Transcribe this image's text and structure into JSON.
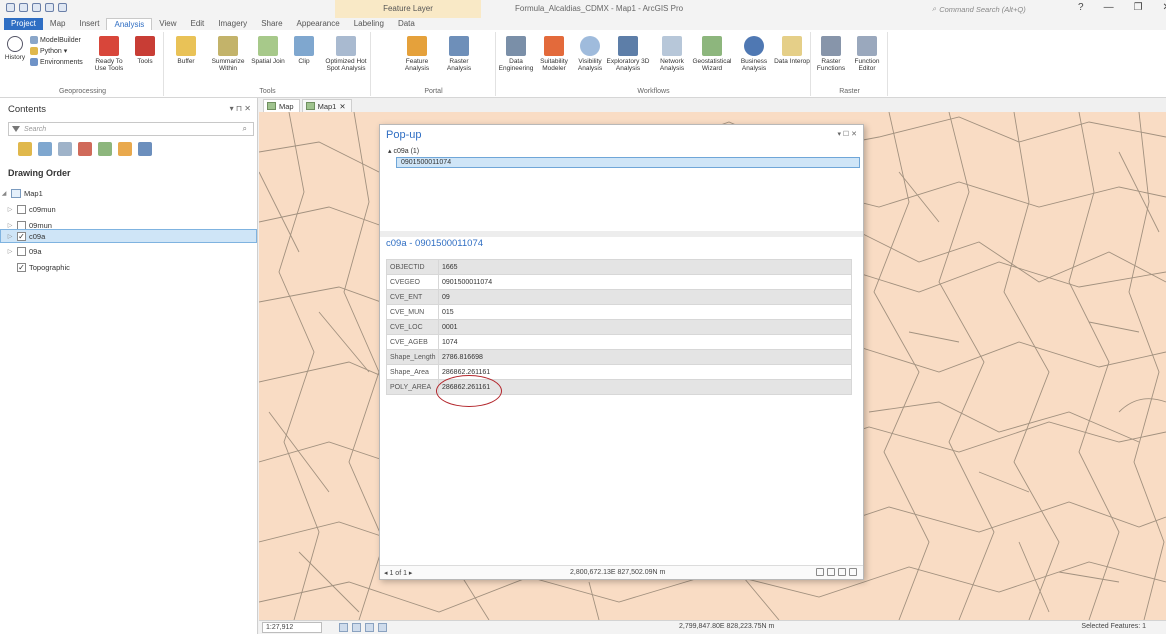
{
  "window": {
    "title": "Formula_Alcaldias_CDMX - Map1 - ArcGIS Pro",
    "contextual_tab": "Feature Layer",
    "command_search": "Command Search (Alt+Q)",
    "help": "?",
    "minimize": "—",
    "restore": "❐",
    "close": "✕"
  },
  "ribbon_tabs": [
    "Project",
    "Map",
    "Insert",
    "Analysis",
    "View",
    "Edit",
    "Imagery",
    "Share",
    "Appearance",
    "Labeling",
    "Data"
  ],
  "ribbon": {
    "geoprocessing": {
      "label": "Geoprocessing",
      "history": "History",
      "modelbuilder": "ModelBuilder",
      "python": "Python",
      "environments": "Environments",
      "ready_to_use": "Ready To Use Tools",
      "tools": "Tools"
    },
    "tools_group": {
      "label": "Tools",
      "buffer": "Buffer",
      "summarize_within": "Summarize Within",
      "spatial_join": "Spatial Join",
      "clip": "Clip",
      "optimized_hot_spot": "Optimized Hot Spot Analysis"
    },
    "portal_group": {
      "label": "Portal",
      "feature_analysis": "Feature Analysis",
      "raster_analysis": "Raster Analysis"
    },
    "workflows_group": {
      "label": "Workflows",
      "data_engineering": "Data Engineering",
      "suitability_modeler": "Suitability Modeler",
      "visibility_analysis": "Visibility Analysis",
      "exploratory_3d": "Exploratory 3D Analysis",
      "network_analysis": "Network Analysis",
      "geostatistical_wizard": "Geostatistical Wizard",
      "business_analysis": "Business Analysis",
      "data_interop": "Data Interop"
    },
    "raster_group": {
      "label": "Raster",
      "raster_functions": "Raster Functions",
      "function_editor": "Function Editor"
    }
  },
  "contents": {
    "title": "Contents",
    "controls": "▾ ⊓ ✕",
    "search_placeholder": "Search",
    "drawing_order": "Drawing Order",
    "map_name": "Map1",
    "layers": [
      {
        "name": "c09mun",
        "checked": false
      },
      {
        "name": "09mun",
        "checked": false
      },
      {
        "name": "c09a",
        "checked": true
      },
      {
        "name": "09a",
        "checked": false
      },
      {
        "name": "Topographic",
        "checked": true
      }
    ]
  },
  "map_tabs": [
    "Map",
    "Map1"
  ],
  "popup": {
    "title": "Pop-up",
    "controls": "▾ ☐ ✕",
    "tree_node": "▴ c09a (1)",
    "tree_leaf": "0901500011074",
    "feature_title": "c09a - 0901500011074",
    "attributes": [
      {
        "field": "OBJECTID",
        "value": "1665"
      },
      {
        "field": "CVEGEO",
        "value": "0901500011074"
      },
      {
        "field": "CVE_ENT",
        "value": "09"
      },
      {
        "field": "CVE_MUN",
        "value": "015"
      },
      {
        "field": "CVE_LOC",
        "value": "0001"
      },
      {
        "field": "CVE_AGEB",
        "value": "1074"
      },
      {
        "field": "Shape_Length",
        "value": "2786.816698"
      },
      {
        "field": "Shape_Area",
        "value": "286862.261161"
      },
      {
        "field": "POLY_AREA",
        "value": "286862.261161"
      }
    ],
    "pager": "◂ 1 of 1 ▸",
    "coords": "2,800,672.13E 827,502.09N m"
  },
  "status": {
    "scale": "1:27,912",
    "coords": "2,799,847.80E 828,223.75N m",
    "selected_features": "Selected Features: 1"
  },
  "colors": {
    "accent": "#2f6ec3",
    "map_fill": "#f9dcc4",
    "road": "#a2917f",
    "highlight_circle": "#b3262c"
  }
}
